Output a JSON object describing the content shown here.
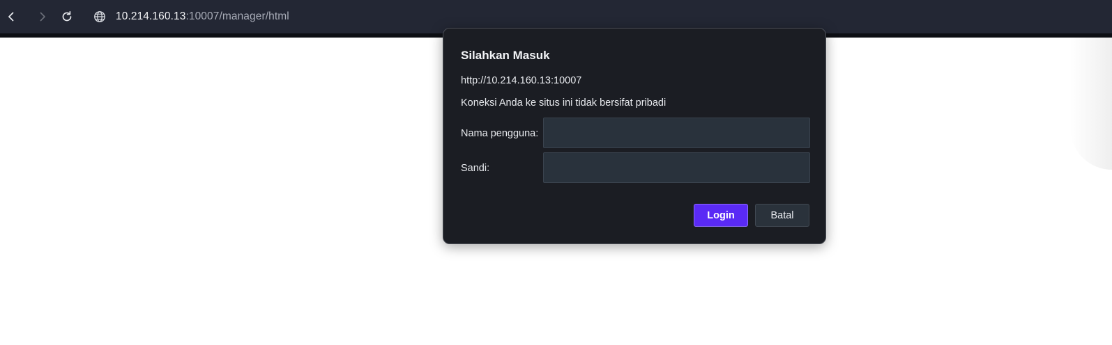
{
  "browser": {
    "url_host": "10.214.160.13",
    "url_rest": ":10007/manager/html",
    "icons": {
      "back": "chevron-left-icon",
      "forward": "chevron-right-icon",
      "reload": "reload-icon",
      "site_info": "globe-icon"
    }
  },
  "dialog": {
    "title": "Silahkan Masuk",
    "origin": "http://10.214.160.13:10007",
    "warning": "Koneksi Anda ke situs ini tidak bersifat pribadi",
    "username_label": "Nama pengguna:",
    "username_value": "",
    "password_label": "Sandi:",
    "password_value": "",
    "login_label": "Login",
    "cancel_label": "Batal"
  },
  "colors": {
    "toolbar_bg": "#232734",
    "dialog_bg": "#1b1d23",
    "primary_button": "#5a2af5",
    "input_bg": "#29323c"
  }
}
